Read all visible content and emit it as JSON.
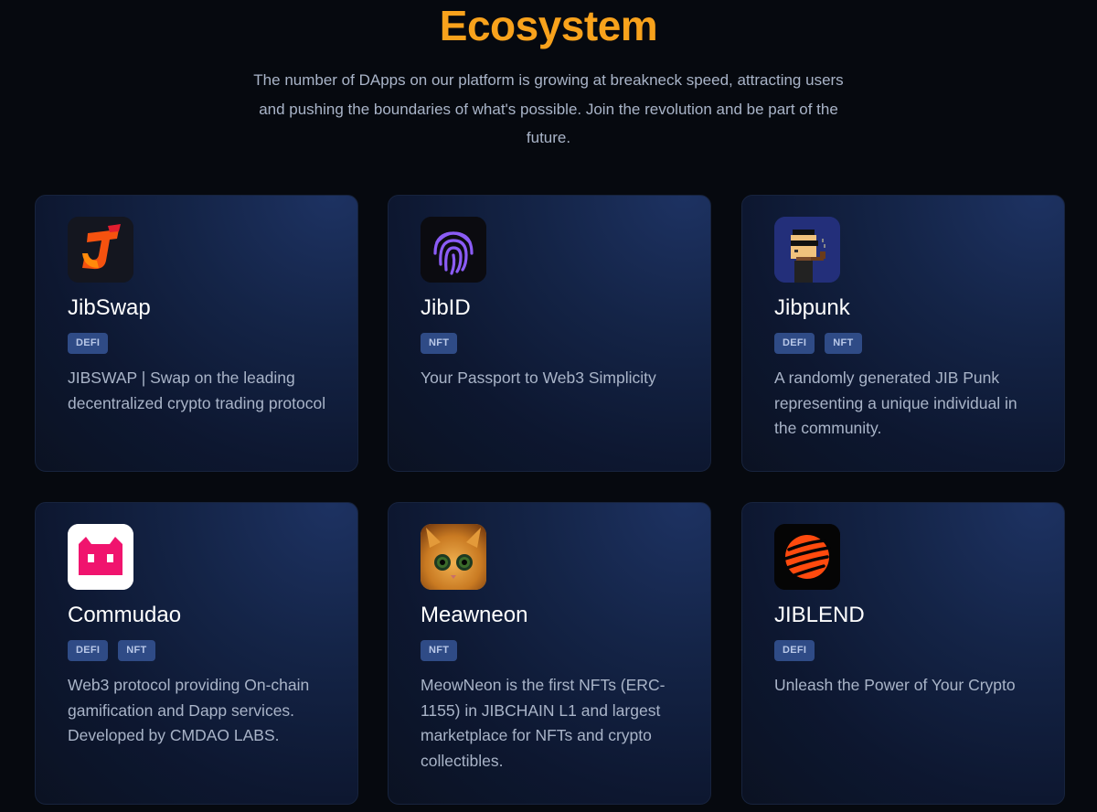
{
  "section": {
    "title": "Ecosystem",
    "subtitle": "The number of DApps on our platform is growing at breakneck speed, attracting users and pushing the boundaries of what's possible. Join the revolution and be part of the future."
  },
  "cards": [
    {
      "name": "JibSwap",
      "tags": [
        "DEFI"
      ],
      "description": "JIBSWAP | Swap on the leading decentralized crypto trading protocol",
      "icon": "jibswap-logo"
    },
    {
      "name": "JibID",
      "tags": [
        "NFT"
      ],
      "description": "Your Passport to Web3 Simplicity",
      "icon": "fingerprint-logo"
    },
    {
      "name": "Jibpunk",
      "tags": [
        "DEFI",
        "NFT"
      ],
      "description": "A randomly generated JIB Punk representing a unique individual in the community.",
      "icon": "pixel-punk-logo"
    },
    {
      "name": "Commudao",
      "tags": [
        "DEFI",
        "NFT"
      ],
      "description": "Web3 protocol providing On-chain gamification and Dapp services. Developed by CMDAO LABS.",
      "icon": "pink-cat-logo"
    },
    {
      "name": "Meawneon",
      "tags": [
        "NFT"
      ],
      "description": "MeowNeon is the first NFTs (ERC-1155) in JIBCHAIN L1 and largest marketplace for NFTs and crypto collectibles.",
      "icon": "cat-photo-logo"
    },
    {
      "name": "JIBLEND",
      "tags": [
        "DEFI"
      ],
      "description": "Unleash the Power of Your Crypto",
      "icon": "orange-planet-logo"
    }
  ],
  "colors": {
    "accent": "#f8a21c",
    "background": "#06090f",
    "tag_bg": "#2f4b86"
  }
}
